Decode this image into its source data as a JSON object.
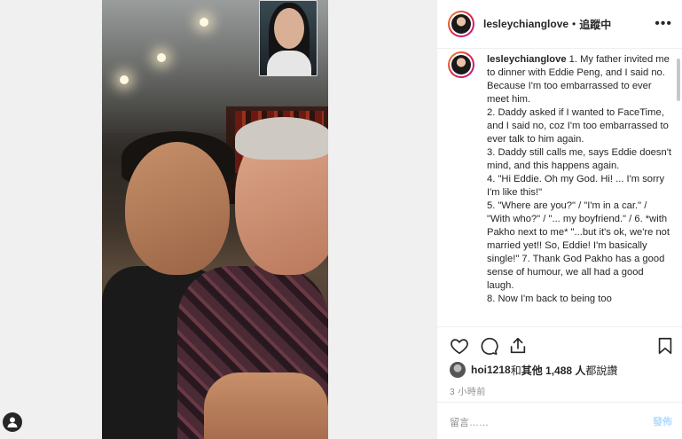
{
  "header": {
    "username": "lesleychianglove",
    "separator": "•",
    "follow_status": "追蹤中",
    "more": "•••"
  },
  "caption": {
    "username": "lesleychianglove",
    "text": " 1. My father invited me to dinner with Eddie Peng, and I said no. Because I'm too embarrassed to ever meet him.\n2. Daddy asked if I wanted to FaceTime, and I said no, coz I'm too embarrassed to ever talk to him again.\n3. Daddy still calls me, says Eddie doesn't mind, and this happens again.\n4. \"Hi Eddie. Oh my God. Hi! ... I'm sorry I'm like this!\"\n5. \"Where are you?\" / \"I'm in a car.\" / \"With who?\" / \"... my boyfriend.\" / 6. *with Pakho next to me* \"...but it's ok, we're not married yet!! So, Eddie! I'm basically single!\" 7. Thank God Pakho has a good sense of humour, we all had a good laugh.\n8. Now I'm back to being too"
  },
  "likes": {
    "user": "hoi1218",
    "connector": " 和 ",
    "others": "其他 1,488 人",
    "suffix": " 都說讚"
  },
  "time": "3 小時前",
  "comment": {
    "placeholder": "留言……",
    "post_label": "發佈"
  },
  "colors": {
    "text": "#262626",
    "muted": "#8e8e8e",
    "post_disabled": "#b3dbff",
    "border": "#efefef"
  }
}
